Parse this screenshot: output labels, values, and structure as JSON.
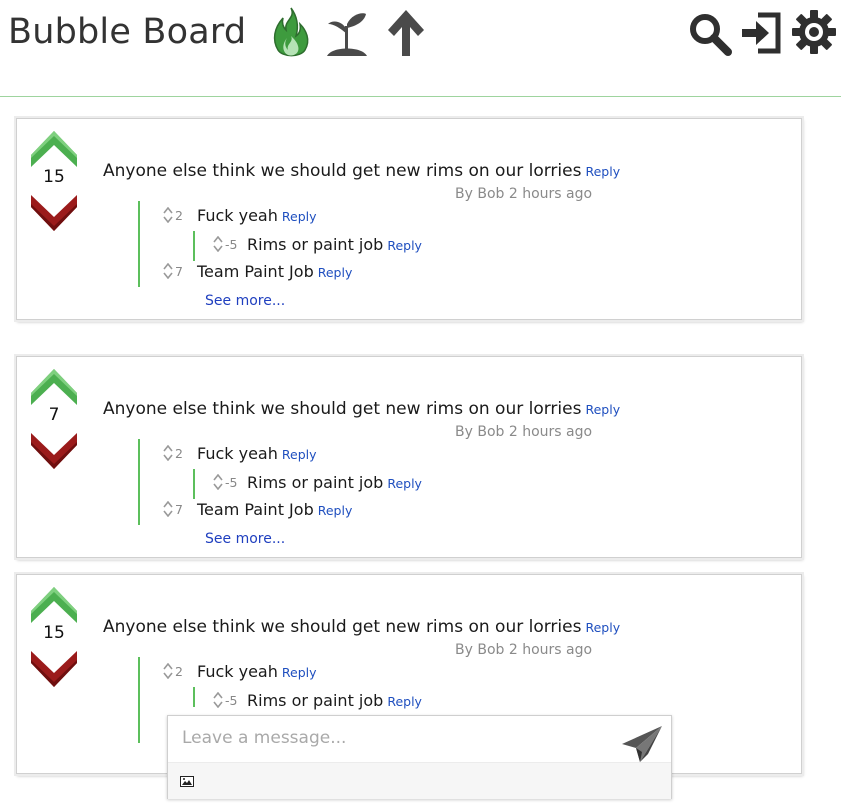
{
  "header": {
    "title": "Bubble Board",
    "icons": [
      "fire-icon",
      "sprout-icon",
      "arrow-up-icon",
      "search-icon",
      "sign-in-icon",
      "gear-icon"
    ],
    "accent": "#4caf50"
  },
  "posts": [
    {
      "score": "15",
      "title": "Anyone else think we should get new rims on our lorries",
      "reply_label": "Reply",
      "meta": "By Bob 2 hours ago",
      "comments": [
        {
          "votes": "2",
          "text": "Fuck yeah",
          "reply_label": "Reply"
        },
        {
          "votes": "-5",
          "text": "Rims or paint job",
          "reply_label": "Reply"
        },
        {
          "votes": "7",
          "text": "Team Paint Job",
          "reply_label": "Reply"
        }
      ],
      "see_more": "See more..."
    },
    {
      "score": "7",
      "title": "Anyone else think we should get new rims on our lorries",
      "reply_label": "Reply",
      "meta": "By Bob 2 hours ago",
      "comments": [
        {
          "votes": "2",
          "text": "Fuck yeah",
          "reply_label": "Reply"
        },
        {
          "votes": "-5",
          "text": "Rims or paint job",
          "reply_label": "Reply"
        },
        {
          "votes": "7",
          "text": "Team Paint Job",
          "reply_label": "Reply"
        }
      ],
      "see_more": "See more..."
    },
    {
      "score": "15",
      "title": "Anyone else think we should get new rims on our lorries",
      "reply_label": "Reply",
      "meta": "By Bob 2 hours ago",
      "comments": [
        {
          "votes": "2",
          "text": "Fuck yeah",
          "reply_label": "Reply"
        },
        {
          "votes": "-5",
          "text": "Rims or paint job",
          "reply_label": "Reply"
        }
      ]
    }
  ],
  "message_box": {
    "placeholder": "Leave a message...",
    "send_icon": "paper-plane-icon",
    "attach_icon": "image-icon"
  },
  "colors": {
    "upvote": "#4caf50",
    "downvote": "#9b1b1b",
    "thread_line": "#5cbf5c",
    "link": "#1f4fbf"
  }
}
